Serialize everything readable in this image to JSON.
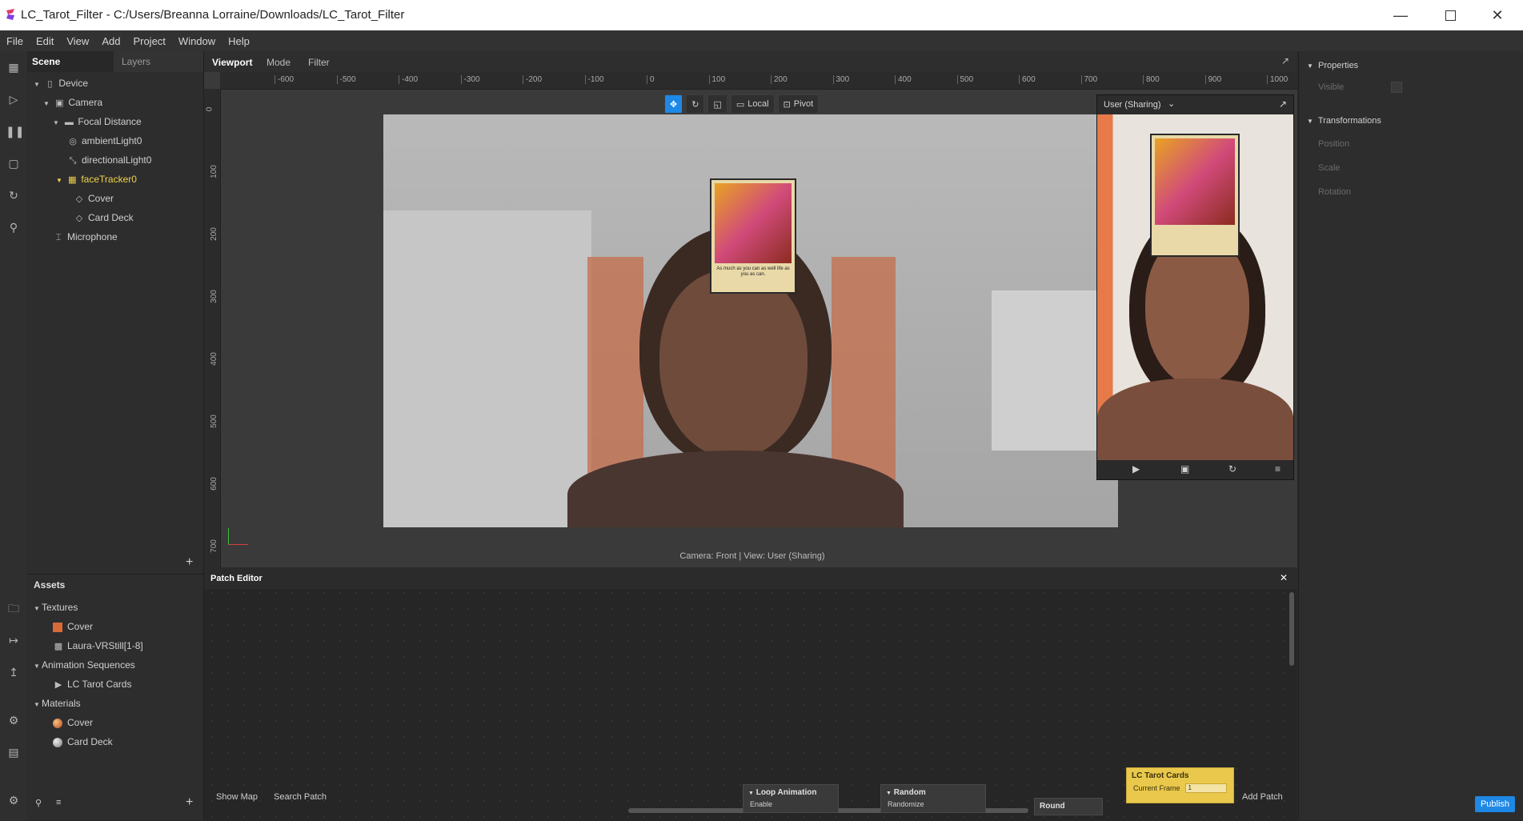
{
  "window": {
    "title": "LC_Tarot_Filter - C:/Users/Breanna Lorraine/Downloads/LC_Tarot_Filter"
  },
  "menu": [
    "File",
    "Edit",
    "View",
    "Add",
    "Project",
    "Window",
    "Help"
  ],
  "scene_panel": {
    "tabs": [
      "Scene",
      "Layers"
    ],
    "tree": [
      {
        "label": "Device",
        "icon": "device-icon",
        "indent": 0
      },
      {
        "label": "Camera",
        "icon": "camera-icon",
        "indent": 1
      },
      {
        "label": "Focal Distance",
        "icon": "focal-distance-icon",
        "indent": 2
      },
      {
        "label": "ambientLight0",
        "icon": "ambient-light-icon",
        "indent": 3
      },
      {
        "label": "directionalLight0",
        "icon": "directional-light-icon",
        "indent": 3
      },
      {
        "label": "faceTracker0",
        "icon": "face-tracker-icon",
        "indent": 3
      },
      {
        "label": "Cover",
        "icon": "plane-icon",
        "indent": 4
      },
      {
        "label": "Card Deck",
        "icon": "plane-icon",
        "indent": 4
      },
      {
        "label": "Microphone",
        "icon": "microphone-icon",
        "indent": 2
      }
    ]
  },
  "assets_panel": {
    "title": "Assets",
    "groups": [
      {
        "label": "Textures",
        "items": [
          "Cover",
          "Laura-VRStill[1-8]"
        ]
      },
      {
        "label": "Animation Sequences",
        "items": [
          "LC Tarot Cards"
        ]
      },
      {
        "label": "Materials",
        "items": [
          "Cover",
          "Card Deck"
        ]
      }
    ]
  },
  "viewport": {
    "tabs": [
      "Viewport",
      "Mode",
      "Filter"
    ],
    "ruler_h": [
      "-600",
      "-500",
      "-400",
      "-300",
      "-200",
      "-100",
      "0",
      "100",
      "200",
      "300",
      "400",
      "500",
      "600",
      "700",
      "800",
      "900",
      "1000"
    ],
    "ruler_v": [
      "0",
      "100",
      "200",
      "300",
      "400",
      "500",
      "600",
      "700"
    ],
    "toolbar": {
      "local": "Local",
      "pivot": "Pivot"
    },
    "camera_label": "Camera: Front | View: User (Sharing)",
    "simulator_label": "User (Sharing)"
  },
  "card_text": "As much as you can as well life as you as can.",
  "properties": {
    "sections": [
      "Properties",
      "Transformations"
    ],
    "visible_label": "Visible",
    "rows": [
      "Position",
      "Scale",
      "Rotation"
    ]
  },
  "patch_editor": {
    "title": "Patch Editor",
    "show_map": "Show Map",
    "search_patch": "Search Patch",
    "add_patch": "Add Patch",
    "nodes": {
      "loop": {
        "title": "Loop Animation",
        "port": "Enable"
      },
      "random": {
        "title": "Random",
        "port": "Randomize"
      },
      "round": {
        "title": "Round"
      },
      "tarot": {
        "title": "LC Tarot Cards",
        "port": "Current Frame",
        "value": "1"
      }
    }
  },
  "publish": "Publish",
  "colors": {
    "accent": "#1e88e5",
    "highlight": "#f0d24a",
    "node_yellow": "#e9c84b"
  }
}
